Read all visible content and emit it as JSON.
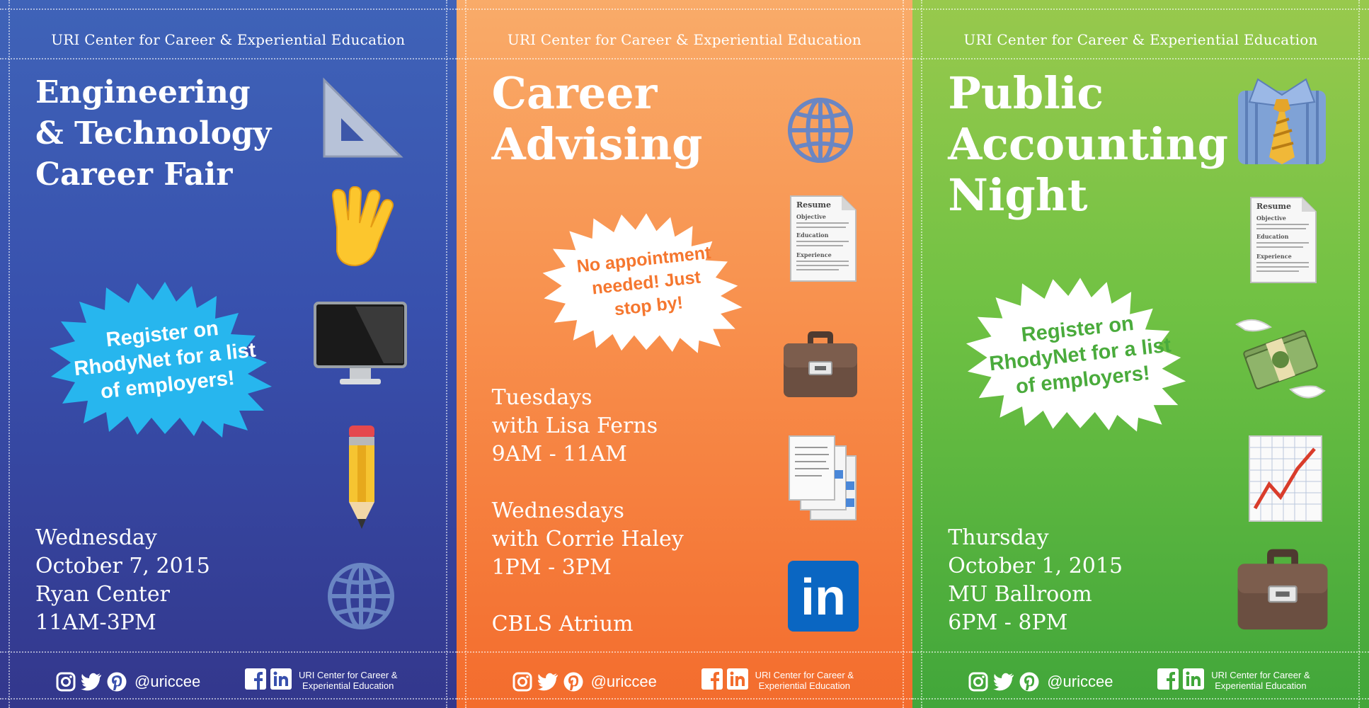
{
  "panels": [
    {
      "org": "URI Center for Career & Experiential Education",
      "title_lines": [
        "Engineering",
        "& Technology",
        "Career Fair"
      ],
      "burst_lines": [
        "Register on",
        "RhodyNet for a list",
        "of employers!"
      ],
      "info_lines": [
        "Wednesday",
        "October 7, 2015",
        "Ryan Center",
        "11AM-3PM"
      ],
      "icons": [
        "triangle-ruler-icon",
        "vulcan-salute-icon",
        "desktop-computer-icon",
        "pencil-icon",
        "globe-icon"
      ],
      "footer": {
        "handle": "@uriccee",
        "org_lines": [
          "URI Center for Career &",
          "Experiential Education"
        ]
      }
    },
    {
      "org": "URI Center for Career & Experiential Education",
      "title_lines": [
        "Career",
        "Advising"
      ],
      "burst_lines": [
        "No appointment",
        "needed! Just",
        "stop by!"
      ],
      "info_lines": [
        "Tuesdays",
        "with Lisa Ferns",
        "9AM - 11AM",
        "",
        "Wednesdays",
        "with Corrie Haley",
        "1PM - 3PM",
        "",
        "CBLS Atrium"
      ],
      "icons": [
        "globe-icon",
        "resume-document-icon",
        "briefcase-icon",
        "documents-stack-icon",
        "linkedin-icon"
      ],
      "footer": {
        "handle": "@uriccee",
        "org_lines": [
          "URI Center for Career &",
          "Experiential Education"
        ]
      }
    },
    {
      "org": "URI Center for Career & Experiential Education",
      "title_lines": [
        "Public",
        "Accounting",
        "Night"
      ],
      "burst_lines": [
        "Register on",
        "RhodyNet for a list",
        "of employers!"
      ],
      "info_lines": [
        "Thursday",
        "October 1, 2015",
        "MU Ballroom",
        "6PM - 8PM"
      ],
      "icons": [
        "shirt-and-tie-icon",
        "resume-document-icon",
        "money-with-wings-icon",
        "chart-increasing-icon",
        "briefcase-icon"
      ],
      "footer": {
        "handle": "@uriccee",
        "org_lines": [
          "URI Center for Career &",
          "Experiential Education"
        ]
      }
    }
  ],
  "resume_doc": {
    "heading": "Resume",
    "sections": [
      "Objective",
      "Education",
      "Experience"
    ]
  },
  "linkedin_text": "in",
  "colors": {
    "blue_panel": "#3850ad",
    "orange_panel": "#f8904d",
    "green_panel": "#6fc143",
    "burst_blue": "#27b6ee",
    "burst_orange_text": "#f5772f",
    "burst_green_text": "#4aab3c",
    "linkedin_blue": "#0a66c2"
  }
}
